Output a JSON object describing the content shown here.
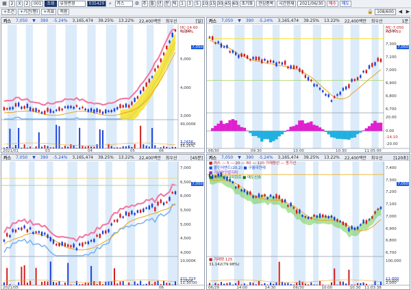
{
  "toolbar1": {
    "nums": [
      "2",
      "X",
      "2"
    ],
    "code_small": "001",
    "search_btn": "조회",
    "account": "유형변경",
    "code": "035420",
    "stock": "카스",
    "period_btns": [
      "주",
      "월",
      "년",
      "분",
      "틱",
      "1",
      "3",
      "5",
      "10",
      "15",
      "30",
      "45",
      "60"
    ],
    "b1": "초기화",
    "b2": "관심종목",
    "b3": "시간현재",
    "date": "2021/06/30",
    "order": "매수",
    "order2": "매도",
    "count": "108/600"
  },
  "toolbar2": {
    "items": [
      "+조건",
      "+기간(행)",
      "+지표",
      "적용"
    ]
  },
  "header": {
    "name": "카스",
    "price": "7,050",
    "arrow": "▼",
    "change": "390",
    "pct": "-5.24%",
    "volume": "3,165,474",
    "rate": "39.25%",
    "ratio": "13.22%",
    "amount": "22,400백만",
    "tag": "최우선"
  },
  "panes": [
    {
      "badge": "[일]",
      "price_tag": "7,050",
      "sub_tags": [
        "HC-14.60",
        "-6.24%"
      ],
      "y_main": [
        "6,000",
        "5,000",
        "4,000",
        "3,000"
      ],
      "y_sub": [
        "40,000K",
        "20,000K"
      ],
      "vol_tags": [
        "3,165K",
        "35.25%"
      ],
      "x_labels": [
        "2021/01",
        "03",
        "04",
        "05",
        "06"
      ]
    },
    {
      "badge": "1분",
      "price_tag": "7,050",
      "sub_tags": [
        "MC-7.050",
        "HC-7.50"
      ],
      "y_main": [
        "7,500",
        "7,300",
        "7,100",
        "7,000",
        "6,900",
        "6,800",
        "6,700"
      ],
      "y_sub": [
        "20.00",
        "0.00",
        "-20.00"
      ],
      "sub_tag": "-14.10",
      "x_labels": [
        "06/30",
        "09:30",
        "10:00",
        "10:30",
        "11:05:00"
      ]
    },
    {
      "badge": "[45분]",
      "price_tag": "7,050",
      "y_main": [
        "7,000",
        "6,500",
        "6,000",
        "5,500",
        "5,000",
        "4,500",
        "4,000"
      ],
      "y_sub": [
        "10,000K",
        "5,000K"
      ],
      "vol_tags": [
        "321,719",
        "11:30:00"
      ],
      "x_labels": [
        "2021/05",
        "06"
      ]
    },
    {
      "badge": "[120초]",
      "price_tag": "7,050",
      "y_main": [
        "7,400",
        "7,300",
        "7,200",
        "7,100",
        "7,000",
        "6,900",
        "6,800",
        "6,700"
      ],
      "y_sub": [
        "100,000",
        "50,000"
      ],
      "vol_tags": [
        "11,000",
        "2,000"
      ],
      "x_labels": [
        "06/29",
        "14:00",
        "14:30",
        "06/30",
        "10:00",
        "10:30",
        "11:03:38"
      ],
      "legend": [
        {
          "text": "■ 카스 — 5 — 20 — 60 — 120 거래량선 — 종가선",
          "color": "#c01818"
        },
        {
          "text": "■ 볼린저밴드(20,2) ■ 구름대현태",
          "color": "#1a4bd0"
        },
        {
          "text": "■ 거래량정렬하라",
          "color": "#7a2fc0"
        },
        {
          "text": "■ 거래량장대학회르 ■ 매도신호",
          "color": "#0a7a20"
        }
      ],
      "vol_label": "■ 거래량 125",
      "vol_label2": "31,142(79.98%)"
    }
  ],
  "colors": {
    "up": "#d01c1c",
    "down": "#1a40d8",
    "band": "#f07aa6",
    "band2": "#7ab2f0",
    "yellow": "#f4e12c",
    "ma": "#e8a21a",
    "bg_stripe": "#dcebf9"
  }
}
